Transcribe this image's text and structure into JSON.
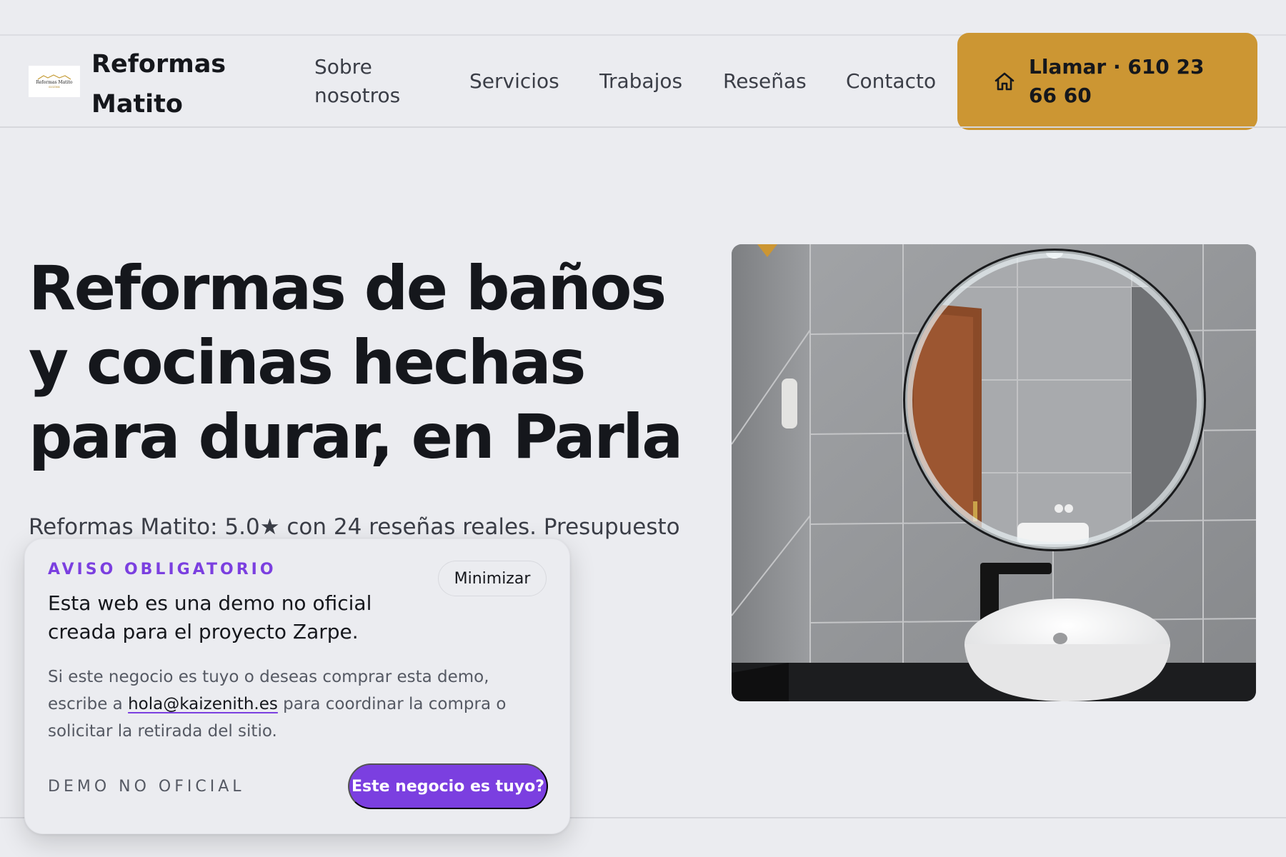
{
  "header": {
    "brand_name": "Reformas Matito",
    "logo_text": "Reformas Matito",
    "logo_sub": "6102366",
    "nav": [
      {
        "label": "Sobre nosotros"
      },
      {
        "label": "Servicios"
      },
      {
        "label": "Trabajos"
      },
      {
        "label": "Reseñas"
      },
      {
        "label": "Contacto"
      }
    ],
    "call_button": "Llamar · 610 23 66 60"
  },
  "hero": {
    "title": "Reformas de baños y cocinas hechas para durar, en Parla",
    "subtitle": "Reformas Matito: 5.0★ con 24 reseñas reales. Presupuesto"
  },
  "notice": {
    "tag": "AVISO OBLIGATORIO",
    "minimize": "Minimizar",
    "heading": "Esta web es una demo no oficial creada para el proyecto Zarpe.",
    "body_before": "Si este negocio es tuyo o deseas comprar esta demo, escribe a ",
    "email": "hola@kaizenith.es",
    "body_after": " para coordinar la compra o solicitar la retirada del sitio.",
    "demo_label": "DEMO NO OFICIAL",
    "claim_button": "Este negocio es tuyo?"
  },
  "colors": {
    "accent": "#cc9633",
    "purple": "#7b3fe0",
    "background": "#ebecf0",
    "text": "#15171c"
  },
  "icons": {
    "call": "home-icon",
    "image": "bathroom-mirror-photo"
  }
}
